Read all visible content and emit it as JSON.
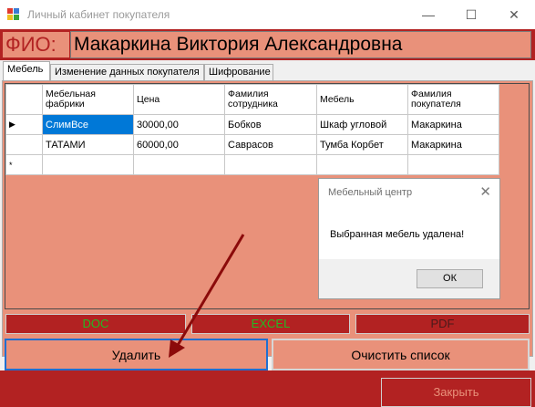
{
  "window": {
    "title": "Личный кабинет покупателя",
    "minimize": "—",
    "maximize": "☐",
    "close": "✕"
  },
  "fio": {
    "label": "ФИО:",
    "value": "Макаркина Виктория Александровна"
  },
  "tabs": [
    {
      "label": "Мебель",
      "active": true
    },
    {
      "label": "Изменение данных покупателя",
      "active": false
    },
    {
      "label": "Шифрование",
      "active": false
    }
  ],
  "grid": {
    "columns": [
      "Мебельная фабрики",
      "Цена",
      "Фамилия сотрудника",
      "Мебель",
      "Фамилия покупателя"
    ],
    "rows": [
      {
        "marker": "▶",
        "cells": [
          "СлимВсе",
          "30000,00",
          "Бобков",
          "Шкаф угловой",
          "Макаркина"
        ]
      },
      {
        "marker": "",
        "cells": [
          "ТАТАМИ",
          "60000,00",
          "Саврасов",
          "Тумба Корбет",
          "Макаркина"
        ]
      },
      {
        "marker": "*",
        "cells": [
          "",
          "",
          "",
          "",
          ""
        ]
      }
    ]
  },
  "message_box": {
    "title": "Мебельный центр",
    "close": "✕",
    "text": "Выбранная мебель удалена!",
    "ok_label": "ОК"
  },
  "export": {
    "doc_label": "DOC",
    "excel_label": "EXCEL",
    "pdf_label": "PDF"
  },
  "actions": {
    "delete_label": "Удалить",
    "clear_label": "Очистить список"
  },
  "footer": {
    "close_label": "Закрыть"
  },
  "colors": {
    "salmon": "#e9917a",
    "dark_red": "#b22222",
    "doc_text": "#22bb22",
    "excel_text": "#22bb22",
    "pdf_text": "#4a1a1a",
    "close_text": "#e9917a",
    "arrow": "#8b0a0a",
    "selection": "#0078d7"
  }
}
